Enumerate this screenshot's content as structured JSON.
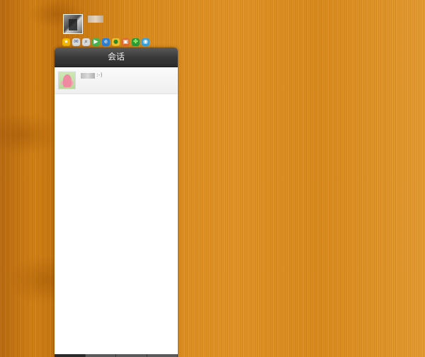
{
  "window": {
    "panel_title": "会话"
  },
  "user": {
    "name": ""
  },
  "plugins": [
    {
      "icon": "favorites-icon",
      "glyph": "★",
      "color": "#f0b400",
      "fg": "#fff"
    },
    {
      "icon": "mail-icon",
      "glyph": "✉",
      "color": "#d9d9d9",
      "fg": "#4a6a9a"
    },
    {
      "icon": "search-icon",
      "glyph": "⌕",
      "color": "#d9d9d9",
      "fg": "#333"
    },
    {
      "icon": "play-icon",
      "glyph": "▶",
      "color": "#4caf50",
      "fg": "#fff"
    },
    {
      "icon": "browser-icon",
      "glyph": "e",
      "color": "#2a7fd4",
      "fg": "#fff"
    },
    {
      "icon": "pet-icon",
      "glyph": "●",
      "color": "#f0c030",
      "fg": "#2a8a2a"
    },
    {
      "icon": "bag-icon",
      "glyph": "▣",
      "color": "#e06a2a",
      "fg": "#fff"
    },
    {
      "icon": "clover-icon",
      "glyph": "✤",
      "color": "#2a9a3a",
      "fg": "#b8ff6a"
    },
    {
      "icon": "chat-icon",
      "glyph": "◉",
      "color": "#3aa0d8",
      "fg": "#fff"
    }
  ],
  "conversations": [
    {
      "name": "",
      "preview": ":-)"
    }
  ]
}
